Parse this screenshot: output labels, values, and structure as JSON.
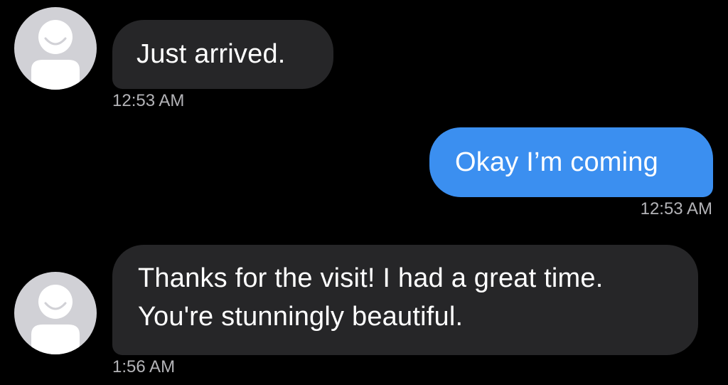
{
  "colors": {
    "background": "#000000",
    "incoming_bubble": "#262628",
    "outgoing_bubble": "#3b8ff0",
    "timestamp_text": "#b3b3b7",
    "avatar_fill": "#d1d1d6"
  },
  "messages": [
    {
      "direction": "incoming",
      "avatar_icon": "default-person-icon",
      "lines": [
        "Just arrived."
      ],
      "time": "12:53 AM"
    },
    {
      "direction": "outgoing",
      "lines": [
        "Okay I’m coming"
      ],
      "time": "12:53 AM"
    },
    {
      "direction": "incoming",
      "avatar_icon": "default-person-icon",
      "lines": [
        "Thanks for the visit! I had a great time.",
        "You're stunningly beautiful."
      ],
      "time": "1:56 AM"
    }
  ]
}
